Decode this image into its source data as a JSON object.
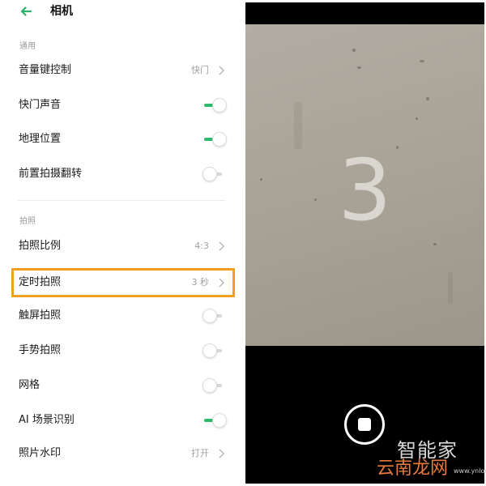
{
  "header": {
    "title": "相机",
    "back_icon": "back-arrow-icon"
  },
  "sections": [
    {
      "heading": "通用",
      "items": [
        {
          "label": "音量键控制",
          "value": "快门",
          "type": "nav"
        },
        {
          "label": "快门声音",
          "type": "toggle",
          "state": "on"
        },
        {
          "label": "地理位置",
          "type": "toggle",
          "state": "on"
        },
        {
          "label": "前置拍摄翻转",
          "type": "toggle",
          "state": "off"
        }
      ]
    },
    {
      "heading": "拍照",
      "items": [
        {
          "label": "拍照比例",
          "value": "4:3",
          "type": "nav"
        },
        {
          "label": "定时拍照",
          "value": "3 秒",
          "type": "nav",
          "highlighted": true
        },
        {
          "label": "触屏拍照",
          "type": "toggle",
          "state": "off"
        },
        {
          "label": "手势拍照",
          "type": "toggle",
          "state": "off"
        },
        {
          "label": "网格",
          "type": "toggle",
          "state": "off"
        },
        {
          "label": "AI 场景识别",
          "type": "toggle",
          "state": "on"
        },
        {
          "label": "照片水印",
          "value": "打开",
          "type": "nav"
        }
      ]
    }
  ],
  "camera": {
    "countdown": "3",
    "shutter_icon": "stop-record-icon"
  },
  "watermark": {
    "line1": "智能家",
    "line2": "云南龙网",
    "line3": "www.ynlong.net"
  },
  "colors": {
    "accent": "#27b36a",
    "toggle_on": "#2dbb6b",
    "highlight_border": "#f0a020"
  }
}
